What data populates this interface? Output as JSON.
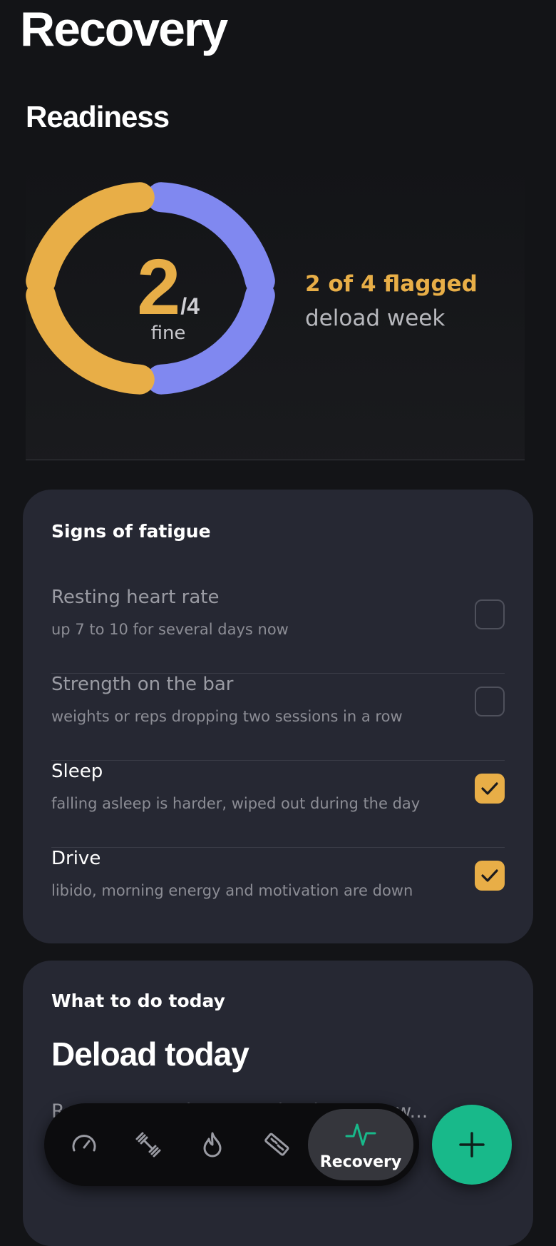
{
  "page": {
    "title": "Recovery"
  },
  "readiness": {
    "heading": "Readiness",
    "score": "2",
    "total": "/4",
    "status": "fine",
    "flagged_text": "2 of 4 flagged",
    "recommendation": "deload week",
    "ring_colors": {
      "flagged": "#e8ae47",
      "fine": "#8088f0"
    }
  },
  "fatigue": {
    "label": "Signs of fatigue",
    "items": [
      {
        "title": "Resting heart rate",
        "desc": "up 7 to 10 for several days now",
        "checked": false
      },
      {
        "title": "Strength on the bar",
        "desc": "weights or reps dropping two sessions in a row",
        "checked": false
      },
      {
        "title": "Sleep",
        "desc": "falling asleep is harder, wiped out during the day",
        "checked": true
      },
      {
        "title": "Drive",
        "desc": "libido, morning energy and motivation are down",
        "checked": true
      }
    ]
  },
  "today": {
    "label": "What to do today",
    "heading": "Deload today",
    "body": "Ro... ...s 2. Today's session is cut ... w..."
  },
  "nav": {
    "tabs": [
      {
        "icon": "speedometer-icon"
      },
      {
        "icon": "dumbbell-icon"
      },
      {
        "icon": "flame-icon"
      },
      {
        "icon": "ruler-icon"
      }
    ],
    "active_label": "Recovery",
    "active_icon": "heartbeat-icon",
    "accent": "#18b98a"
  },
  "fab": {
    "icon": "plus-icon"
  }
}
